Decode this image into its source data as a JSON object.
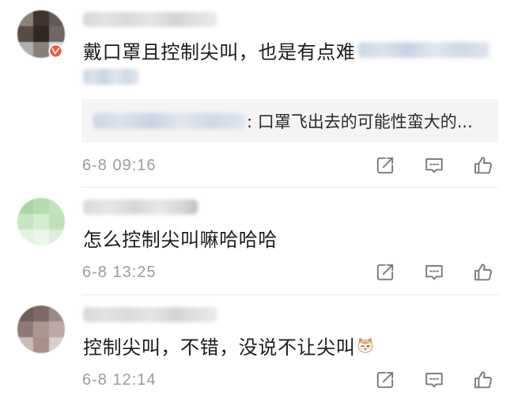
{
  "comments": [
    {
      "text": "戴口罩且控制尖叫，也是有点难",
      "quote_text": ": 口罩飞出去的可能性蛮大的...",
      "timestamp": "6-8 09:16"
    },
    {
      "text": "怎么控制尖叫嘛哈哈哈",
      "timestamp": "6-8 13:25"
    },
    {
      "text": "控制尖叫，不错，没说不让尖叫",
      "emoji": "cat-emoji-icon",
      "timestamp": "6-8 12:14"
    }
  ],
  "icons": {
    "avatar_badge": "avatar-badge-icon",
    "forward": "forward-icon",
    "reply": "comment-icon",
    "like": "like-icon"
  },
  "colors": {
    "text": "#1c1c1c",
    "quote_text": "#2b2b2b",
    "meta": "#9b9b9b",
    "icon": "#7b7b7b",
    "quote_bg": "#f4f4f4",
    "divider": "#e6e6e6",
    "badge": "#ee5a3c"
  }
}
